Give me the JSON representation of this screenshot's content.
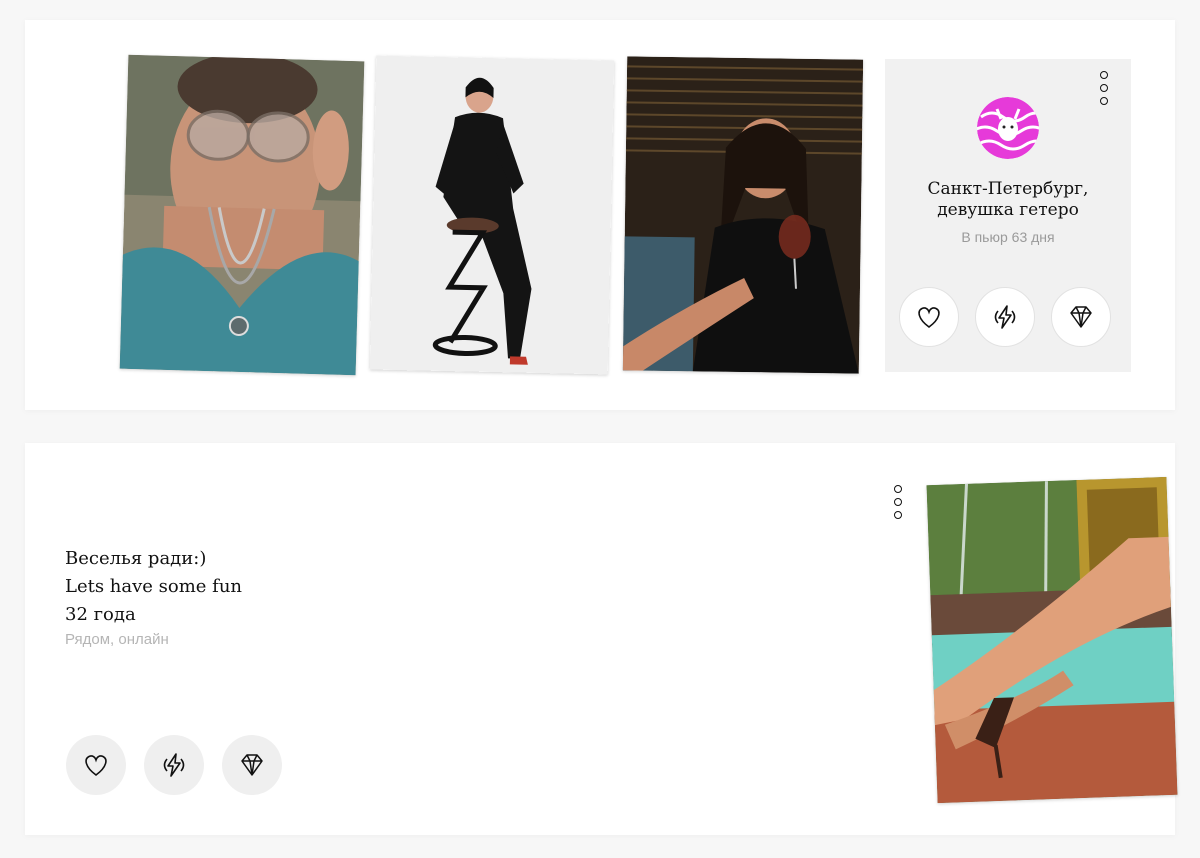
{
  "profile_card": {
    "photos": [
      {
        "icon": "photo-woman-sunglasses"
      },
      {
        "icon": "photo-woman-bar-stool"
      },
      {
        "icon": "photo-woman-wine-glass"
      }
    ],
    "avatar_icon": "avatar-pink-illustration",
    "location_line1": "Санкт-Петербург,",
    "location_line2": "девушка гетеро",
    "since_text": "В пьюр 63 дня",
    "more_icon": "more-vertical-icon",
    "actions": [
      {
        "icon": "heart-icon"
      },
      {
        "icon": "lightning-icon"
      },
      {
        "icon": "diamond-icon"
      }
    ]
  },
  "post_card": {
    "title": "Веселья ради:)",
    "subtitle": "Lets have some fun",
    "age": "32 года",
    "status": "Рядом, онлайн",
    "more_icon": "more-vertical-icon",
    "photo_icon": "photo-legs-fountain",
    "actions": [
      {
        "icon": "heart-icon"
      },
      {
        "icon": "lightning-icon"
      },
      {
        "icon": "diamond-icon"
      }
    ]
  },
  "colors": {
    "page_bg": "#f7f7f7",
    "card_bg": "#ffffff",
    "panel_bg": "#f1f1f1",
    "muted_text": "#9a9a9a",
    "avatar_pink": "#e63ad9"
  }
}
